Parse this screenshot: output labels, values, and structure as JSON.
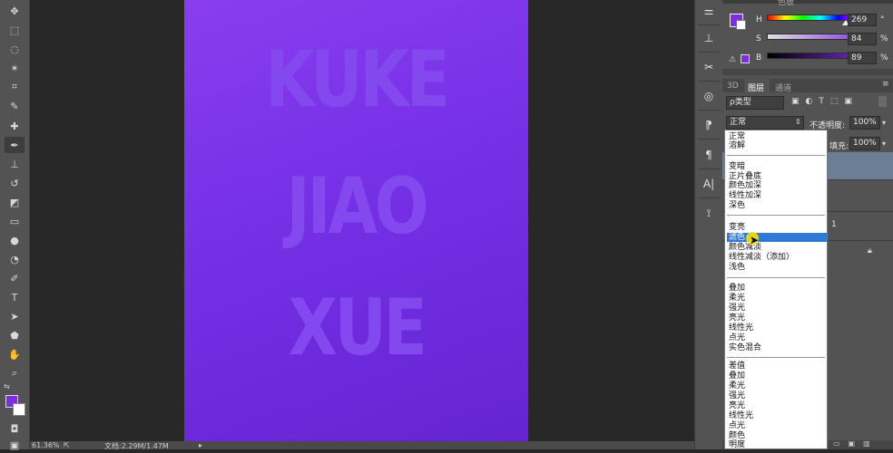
{
  "colors": {
    "canvas_top": "#8a3df0",
    "canvas_bottom": "#6524d3",
    "canvas_text": "#8449ee",
    "ui_panel": "#535353",
    "selection": "#2f7ad4",
    "foreground_swatch": "#7d2ee4"
  },
  "toolbar": {
    "tools": [
      "move-tool",
      "marquee-tool",
      "lasso-tool",
      "quick-select-tool",
      "crop-tool",
      "eyedropper-tool",
      "healing-brush-tool",
      "brush-tool",
      "clone-stamp-tool",
      "history-brush-tool",
      "eraser-tool",
      "gradient-tool",
      "blur-tool",
      "dodge-tool",
      "pen-tool",
      "type-tool",
      "path-select-tool",
      "shape-tool",
      "hand-tool",
      "zoom-tool"
    ]
  },
  "canvas": {
    "lines": [
      "KUKE",
      "JIAO",
      "XUE"
    ]
  },
  "status": {
    "zoom": "61.36%",
    "doc_size": "文档:2.29M/1.47M"
  },
  "color_panel": {
    "tabs": [
      "色板"
    ],
    "h": {
      "label": "H",
      "value": "269",
      "unit": "°",
      "level": 0.75
    },
    "s": {
      "label": "S",
      "value": "84",
      "unit": "%",
      "level": 0.84
    },
    "b": {
      "label": "B",
      "value": "89",
      "unit": "%",
      "level": 0.89
    }
  },
  "layers_panel": {
    "tabs": [
      "3D",
      "图层",
      "通道"
    ],
    "filter": "ρ类型",
    "blend_mode": "正常",
    "opacity_label": "不透明度:",
    "opacity_value": "100%",
    "fill_label": "填充:",
    "fill_value": "100%",
    "layer_partial_name": "1"
  },
  "blend_dropdown": {
    "groups": [
      [
        "正常",
        "溶解"
      ],
      [
        "变暗",
        "正片叠底",
        "颜色加深",
        "线性加深",
        "深色"
      ],
      [
        "变亮",
        "滤色",
        "颜色减淡",
        "线性减淡（添加）",
        "浅色"
      ],
      [
        "叠加",
        "柔光",
        "强光",
        "亮光",
        "线性光",
        "点光",
        "实色混合"
      ],
      [
        "差值",
        "叠加",
        "柔光",
        "强光",
        "亮光",
        "线性光",
        "点光",
        "颜色",
        "明度"
      ]
    ],
    "selected": "滤色"
  }
}
